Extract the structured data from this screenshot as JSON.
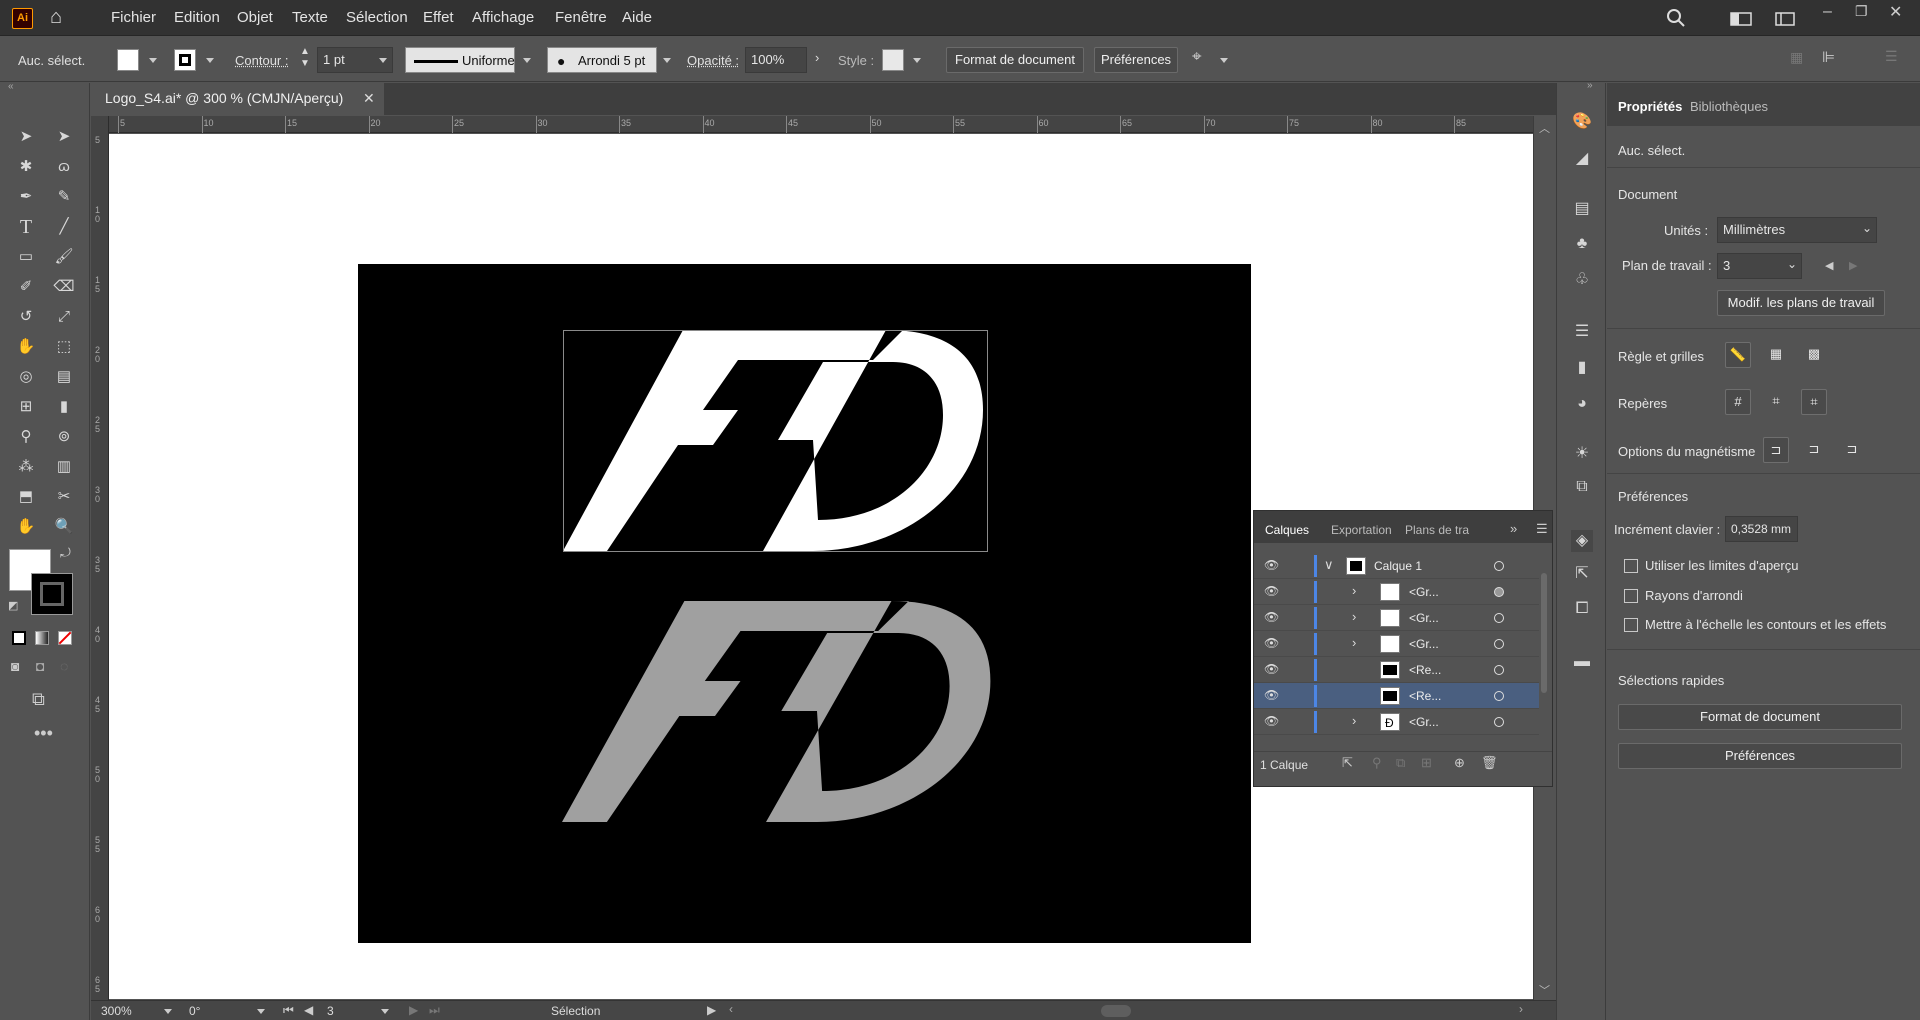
{
  "app": {
    "logo": "Ai",
    "accent": "#ff9a00"
  },
  "menu": [
    "Fichier",
    "Edition",
    "Objet",
    "Texte",
    "Sélection",
    "Effet",
    "Affichage",
    "Fenêtre",
    "Aide"
  ],
  "control_bar": {
    "selection_label": "Auc. sélect.",
    "stroke_label": "Contour :",
    "stroke_weight": "1 pt",
    "stroke_profile": "Uniforme",
    "brush": "Arrondi 5 pt",
    "opacity_label": "Opacité :",
    "opacity_value": "100%",
    "style_label": "Style :",
    "doc_setup_btn": "Format de document",
    "prefs_btn": "Préférences"
  },
  "document": {
    "tab_title": "Logo_S4.ai* @ 300 % (CMJN/Aperçu)",
    "ruler_top": [
      "5",
      "10",
      "15",
      "20",
      "25",
      "30",
      "35",
      "40",
      "45",
      "50",
      "55",
      "60",
      "65",
      "70",
      "75",
      "80",
      "85"
    ],
    "ruler_left": [
      "5",
      "1\n0",
      "1\n5",
      "2\n0",
      "2\n5",
      "3\n0",
      "3\n5",
      "4\n0",
      "4\n5",
      "5\n0",
      "5\n5",
      "6\n0",
      "6\n5"
    ],
    "artwork": {
      "top_logo_color": "#ffffff",
      "bottom_logo_color": "#a0a0a0",
      "background": "#000000"
    }
  },
  "status": {
    "zoom": "300%",
    "rotation": "0°",
    "artboard": "3",
    "mode": "Sélection"
  },
  "layers_panel": {
    "tabs": [
      "Calques",
      "Exportation",
      "Plans de tra"
    ],
    "rows": [
      {
        "name": "Calque 1",
        "expand": "∨",
        "selected": false
      },
      {
        "name": "<Gr...",
        "expand": "›",
        "selected": false
      },
      {
        "name": "<Gr...",
        "expand": "›",
        "selected": false
      },
      {
        "name": "<Gr...",
        "expand": "›",
        "selected": false
      },
      {
        "name": "<Re...",
        "expand": "",
        "selected": false
      },
      {
        "name": "<Re...",
        "expand": "",
        "selected": true
      },
      {
        "name": "<Gr...",
        "expand": "›",
        "selected": false
      }
    ],
    "footer": "1 Calque"
  },
  "properties": {
    "tab_props": "Propriétés",
    "tab_libs": "Bibliothèques",
    "no_selection": "Auc. sélect.",
    "document_section": "Document",
    "units_label": "Unités :",
    "units_value": "Millimètres",
    "artboard_label": "Plan de travail :",
    "artboard_value": "3",
    "edit_artboards_btn": "Modif. les plans de travail",
    "rulers_label": "Règle et grilles",
    "guides_label": "Repères",
    "snap_label": "Options du magnétisme",
    "prefs_section": "Préférences",
    "increment_label": "Incrément clavier :",
    "increment_value": "0,3528 mm",
    "checkboxes": [
      "Utiliser les limites d'aperçu",
      "Rayons d'arrondi",
      "Mettre à l'échelle les contours et les effets"
    ],
    "quick_actions": "Sélections rapides",
    "doc_setup_btn": "Format de document",
    "prefs_btn": "Préférences"
  }
}
